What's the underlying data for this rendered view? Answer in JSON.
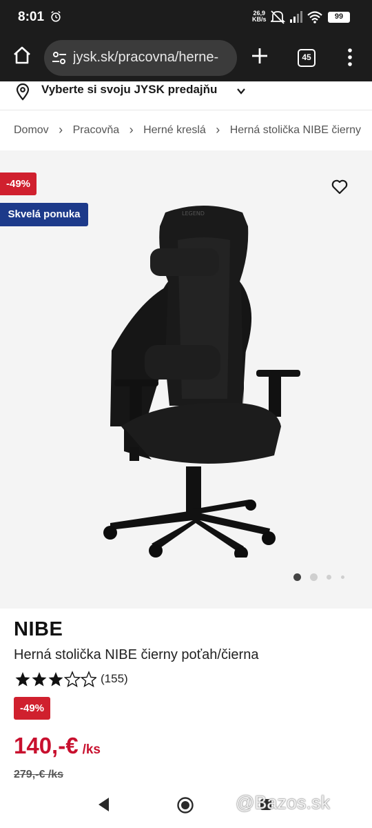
{
  "status_bar": {
    "time": "8:01",
    "speed_value": "26,9",
    "speed_unit": "KB/s",
    "battery": "99",
    "icons": [
      "alarm-icon",
      "mute-icon",
      "signal-icon",
      "wifi-icon",
      "battery-icon"
    ]
  },
  "browser": {
    "url": "jysk.sk/pracovna/herne-",
    "tab_count": "45",
    "icons": [
      "home-icon",
      "tune-icon",
      "plus-icon",
      "tabs-icon",
      "more-vert-icon"
    ]
  },
  "store_selector": {
    "label": "Vyberte si svoju JYSK predajňu",
    "icons": [
      "location-pin-icon",
      "chevron-down-icon"
    ]
  },
  "breadcrumb": {
    "items": [
      "Domov",
      "Pracovňa",
      "Herné kreslá",
      "Herná stolička NIBE čierny"
    ],
    "separator": "›"
  },
  "gallery": {
    "discount_badge": "-49%",
    "offer_badge": "Skvelá ponuka",
    "image_alt": "gaming-chair",
    "active_dot": 1,
    "dot_count": 4
  },
  "product": {
    "brand": "NIBE",
    "name": "Herná stolička NIBE čierny poťah/čierna",
    "rating": 3.5,
    "rating_max": 5,
    "review_count": "(155)",
    "discount_badge": "-49%",
    "price": "140,-€",
    "price_unit": "/ks",
    "old_price": "279,-€ /ks"
  },
  "colors": {
    "discount_red": "#d0202e",
    "price_red": "#c8102e",
    "offer_blue": "#1d3a8a",
    "status_bar_bg": "#1c1c1c"
  },
  "nav_bar": {
    "icons": [
      "back-icon",
      "home-circle-icon",
      "recent-apps-icon"
    ],
    "watermark": "@Bazos.sk"
  }
}
